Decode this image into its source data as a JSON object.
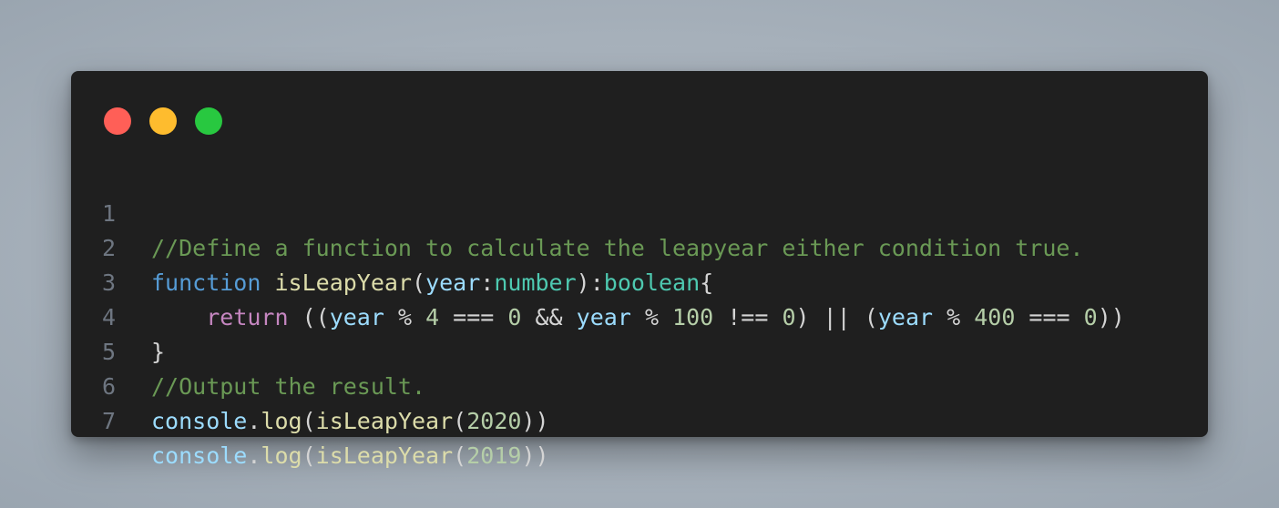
{
  "window": {
    "controls": [
      "close",
      "minimize",
      "maximize"
    ],
    "colors": {
      "close": "#ff5f57",
      "minimize": "#febc2e",
      "maximize": "#28c840",
      "background": "#1f1f1f"
    }
  },
  "code": {
    "line_numbers": [
      "1",
      "2",
      "3",
      "4",
      "5",
      "6",
      "7"
    ],
    "line1": {
      "comment": "//Define a function to calculate the leapyear either condition true."
    },
    "line2": {
      "kw": "function",
      "sp1": " ",
      "fname": "isLeapYear",
      "p1": "(",
      "param": "year",
      "colon1": ":",
      "ptype": "number",
      "p2": "):",
      "rtype": "boolean",
      "brace": "{"
    },
    "line3": {
      "indent": "    ",
      "kw": "return",
      "t1": " ((",
      "v1": "year",
      "t2": " % ",
      "n1": "4",
      "t3": " === ",
      "n2": "0",
      "t4": " && ",
      "v2": "year",
      "t5": " % ",
      "n3": "100",
      "t6": " !== ",
      "n4": "0",
      "t7": ") || (",
      "v3": "year",
      "t8": " % ",
      "n5": "400",
      "t9": " === ",
      "n6": "0",
      "t10": "))"
    },
    "line4": {
      "brace": "}"
    },
    "line5": {
      "comment": "//Output the result."
    },
    "line6": {
      "obj": "console",
      "dot": ".",
      "method": "log",
      "p1": "(",
      "fname": "isLeapYear",
      "p2": "(",
      "arg": "2020",
      "p3": "))"
    },
    "line7": {
      "obj": "console",
      "dot": ".",
      "method": "log",
      "p1": "(",
      "fname": "isLeapYear",
      "p2": "(",
      "arg": "2019",
      "p3": "))"
    }
  }
}
